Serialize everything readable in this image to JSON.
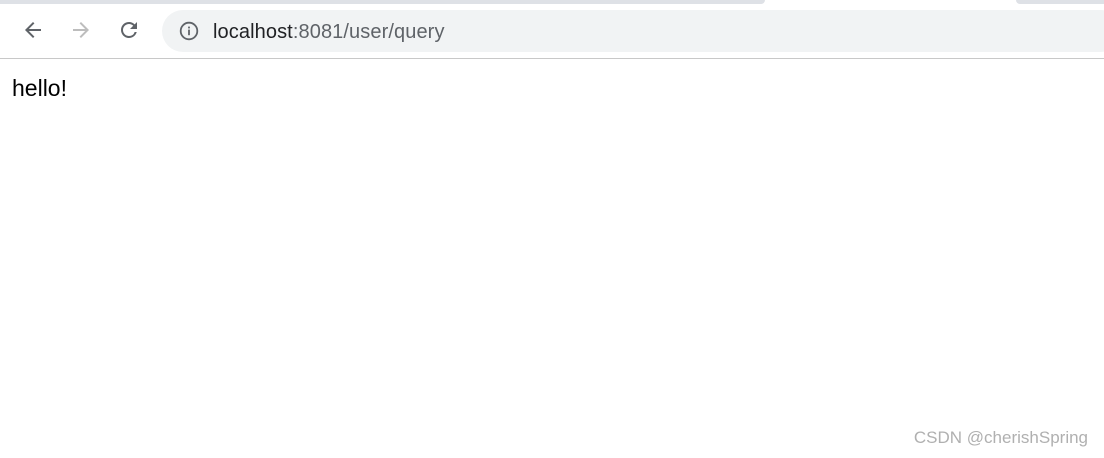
{
  "browser": {
    "nav": {
      "back_icon": "arrow-left-icon",
      "forward_icon": "arrow-right-icon",
      "reload_icon": "reload-icon",
      "forward_enabled": false
    },
    "address_bar": {
      "info_icon": "info-circle-icon",
      "url_host": "localhost",
      "url_rest": ":8081/user/query"
    }
  },
  "page": {
    "body_text": "hello!"
  },
  "watermark": {
    "text": "CSDN @cherishSpring"
  },
  "colors": {
    "omnibox_bg": "#f1f3f4",
    "icon_active": "#5f6368",
    "icon_disabled": "#bdbdbd",
    "tab_strip": "#dee1e6"
  }
}
